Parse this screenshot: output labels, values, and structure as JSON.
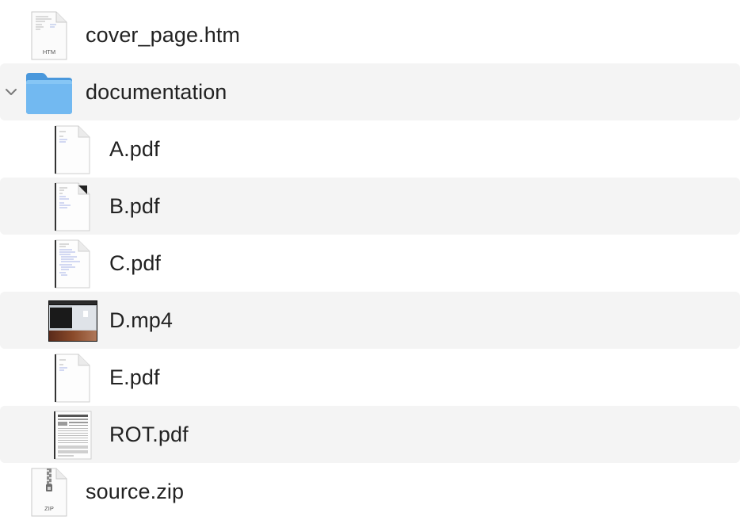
{
  "file_list": {
    "rows": [
      {
        "name": "cover_page.htm",
        "icon": "html-file-icon",
        "badge": "HTM"
      },
      {
        "name": "documentation",
        "icon": "folder-icon",
        "expanded": true
      },
      {
        "name": "A.pdf",
        "icon": "pdf-file-icon"
      },
      {
        "name": "B.pdf",
        "icon": "pdf-file-icon"
      },
      {
        "name": "C.pdf",
        "icon": "pdf-file-icon"
      },
      {
        "name": "D.mp4",
        "icon": "video-thumbnail-icon"
      },
      {
        "name": "E.pdf",
        "icon": "pdf-file-icon"
      },
      {
        "name": "ROT.pdf",
        "icon": "pdf-file-icon"
      },
      {
        "name": "source.zip",
        "icon": "zip-file-icon",
        "badge": "ZIP"
      }
    ]
  },
  "colors": {
    "row_alt_background": "#f4f4f4",
    "folder_blue": "#6cb6f0",
    "text": "#222222"
  }
}
